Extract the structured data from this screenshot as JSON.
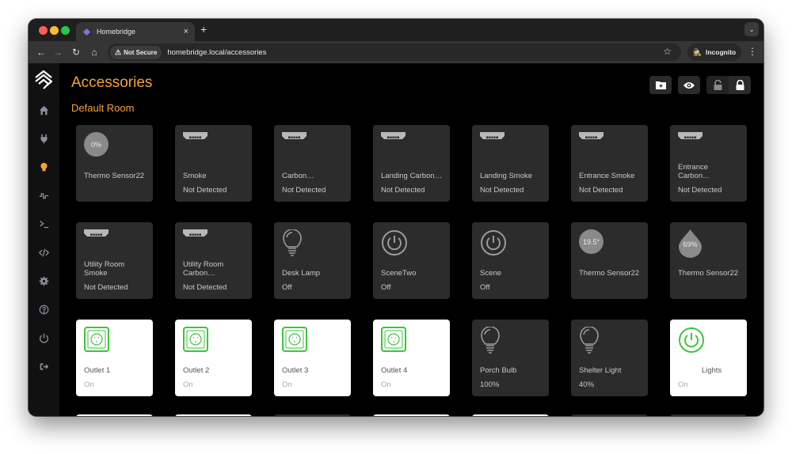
{
  "browser": {
    "tab_title": "Homebridge",
    "new_tab": "+",
    "close_tab": "×",
    "security_label": "Not Secure",
    "url": "homebridge.local/accessories",
    "incognito_label": "Incognito"
  },
  "app": {
    "page_title": "Accessories",
    "room_title": "Default Room",
    "accent_color": "#f4a33b",
    "sidebar": [
      {
        "name": "home",
        "active": false
      },
      {
        "name": "plugins",
        "active": false
      },
      {
        "name": "accessories",
        "active": true
      },
      {
        "name": "status",
        "active": false
      },
      {
        "name": "terminal",
        "active": false
      },
      {
        "name": "config-editor",
        "active": false
      },
      {
        "name": "settings",
        "active": false
      },
      {
        "name": "help",
        "active": false
      },
      {
        "name": "power",
        "active": false
      },
      {
        "name": "logout",
        "active": false
      }
    ],
    "actions": [
      "add-room",
      "show-hidden",
      "unlock-layout",
      "lock-layout"
    ]
  },
  "tiles": [
    {
      "type": "humidity-circle",
      "value": "0%",
      "name": "Thermo Sensor22",
      "status": "",
      "on": false
    },
    {
      "type": "smoke",
      "name": "Smoke",
      "status": "Not Detected",
      "on": false
    },
    {
      "type": "smoke",
      "name": "Carbon…",
      "status": "Not Detected",
      "on": false
    },
    {
      "type": "smoke",
      "name": "Landing Carbon…",
      "status": "Not Detected",
      "on": false
    },
    {
      "type": "smoke",
      "name": "Landing Smoke",
      "status": "Not Detected",
      "on": false
    },
    {
      "type": "smoke",
      "name": "Entrance Smoke",
      "status": "Not Detected",
      "on": false
    },
    {
      "type": "smoke",
      "name": "Entrance Carbon…",
      "status": "Not Detected",
      "on": false
    },
    {
      "type": "smoke",
      "name": "Utility Room Smoke",
      "status": "Not Detected",
      "on": false
    },
    {
      "type": "smoke",
      "name": "Utility Room Carbon…",
      "status": "Not Detected",
      "on": false
    },
    {
      "type": "bulb",
      "name": "Desk Lamp",
      "status": "Off",
      "on": false
    },
    {
      "type": "power",
      "name": "SceneTwo",
      "status": "Off",
      "on": false
    },
    {
      "type": "power",
      "name": "Scene",
      "status": "Off",
      "on": false
    },
    {
      "type": "temp-circle",
      "value": "19.5°",
      "name": "Thermo Sensor22",
      "status": "",
      "on": false
    },
    {
      "type": "humidity-drop",
      "value": "69%",
      "name": "Thermo Sensor22",
      "status": "",
      "on": false
    },
    {
      "type": "outlet",
      "name": "Outlet 1",
      "status": "On",
      "on": true
    },
    {
      "type": "outlet",
      "name": "Outlet 2",
      "status": "On",
      "on": true
    },
    {
      "type": "outlet",
      "name": "Outlet 3",
      "status": "On",
      "on": true
    },
    {
      "type": "outlet",
      "name": "Outlet 4",
      "status": "On",
      "on": true
    },
    {
      "type": "bulb",
      "name": "Porch Bulb",
      "status": "100%",
      "on": false
    },
    {
      "type": "bulb",
      "name": "Shelter Light",
      "status": "40%",
      "on": false
    },
    {
      "type": "power",
      "name": "Lights",
      "status": "On",
      "on": true
    }
  ],
  "partial_row_on": [
    true,
    true,
    false,
    true,
    true,
    false,
    false
  ],
  "colors": {
    "on_green": "#3dc53d",
    "tile_dark": "#2c2c2c",
    "tile_on": "#ffffff"
  }
}
